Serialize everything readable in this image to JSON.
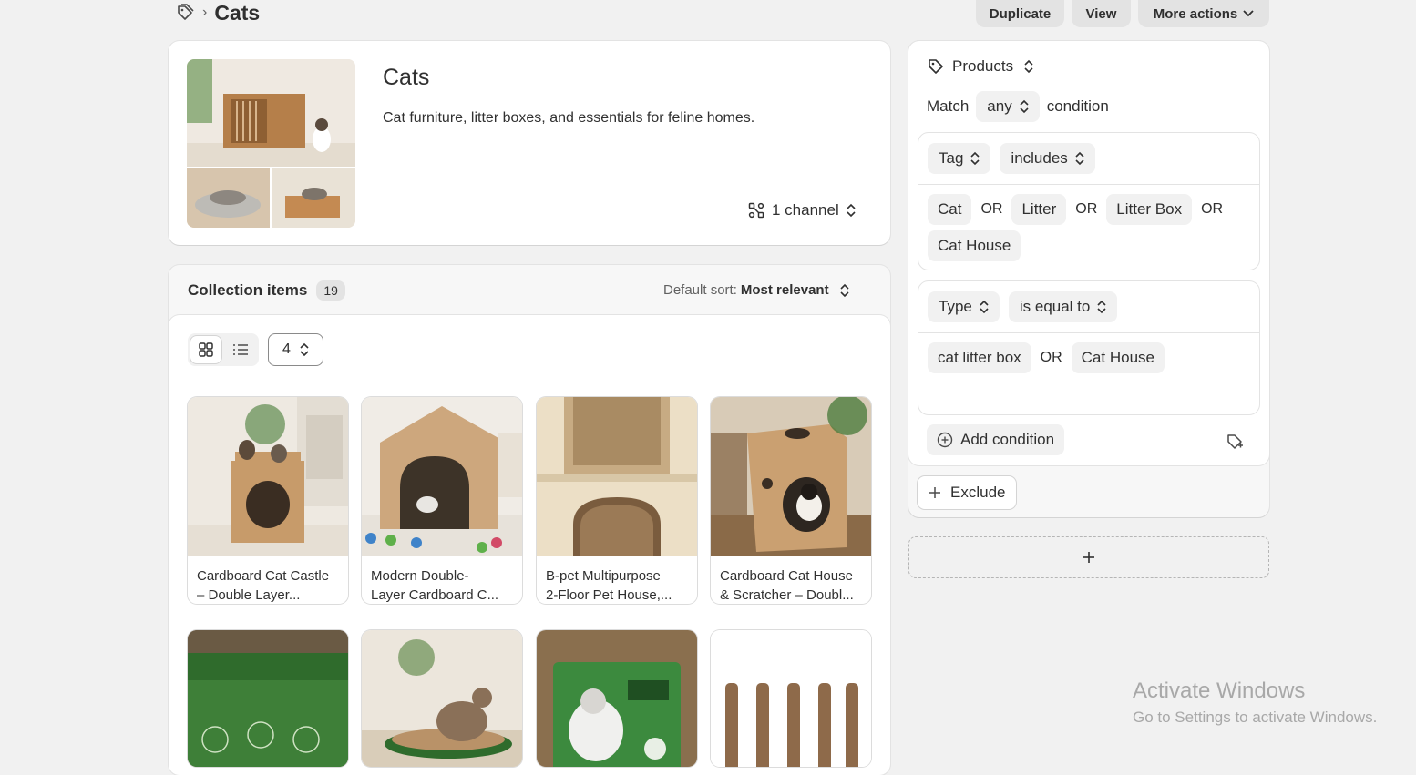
{
  "header": {
    "title": "Cats",
    "buttons": {
      "duplicate": "Duplicate",
      "view": "View",
      "more_actions": "More actions"
    }
  },
  "collection": {
    "title": "Cats",
    "description": "Cat furniture, litter boxes, and essentials for feline homes.",
    "channels": "1 channel"
  },
  "items": {
    "heading": "Collection items",
    "count": "19",
    "sort_label": "Default sort:",
    "sort_value": "Most relevant",
    "columns_value": "4",
    "products": [
      {
        "line1": "Cardboard Cat Castle",
        "line2": "– Double Layer..."
      },
      {
        "line1": "Modern Double-",
        "line2": "Layer Cardboard C..."
      },
      {
        "line1": "B-pet Multipurpose",
        "line2": "2-Floor Pet House,..."
      },
      {
        "line1": "Cardboard Cat House",
        "line2": "& Scratcher – Doubl..."
      }
    ]
  },
  "conditions": {
    "type_label": "Products",
    "match_label": "Match",
    "match_value": "any",
    "condition_label": "condition",
    "group1": {
      "field": "Tag",
      "operator": "includes",
      "values": [
        "Cat",
        "Litter",
        "Litter Box",
        "Cat House"
      ],
      "joiner": "OR"
    },
    "group2": {
      "field": "Type",
      "operator": "is equal to",
      "values": [
        "cat litter box",
        "Cat House"
      ],
      "joiner": "OR"
    },
    "add_condition": "Add condition",
    "exclude": "Exclude"
  },
  "watermark": {
    "title": "Activate Windows",
    "subtitle": "Go to Settings to activate Windows."
  }
}
